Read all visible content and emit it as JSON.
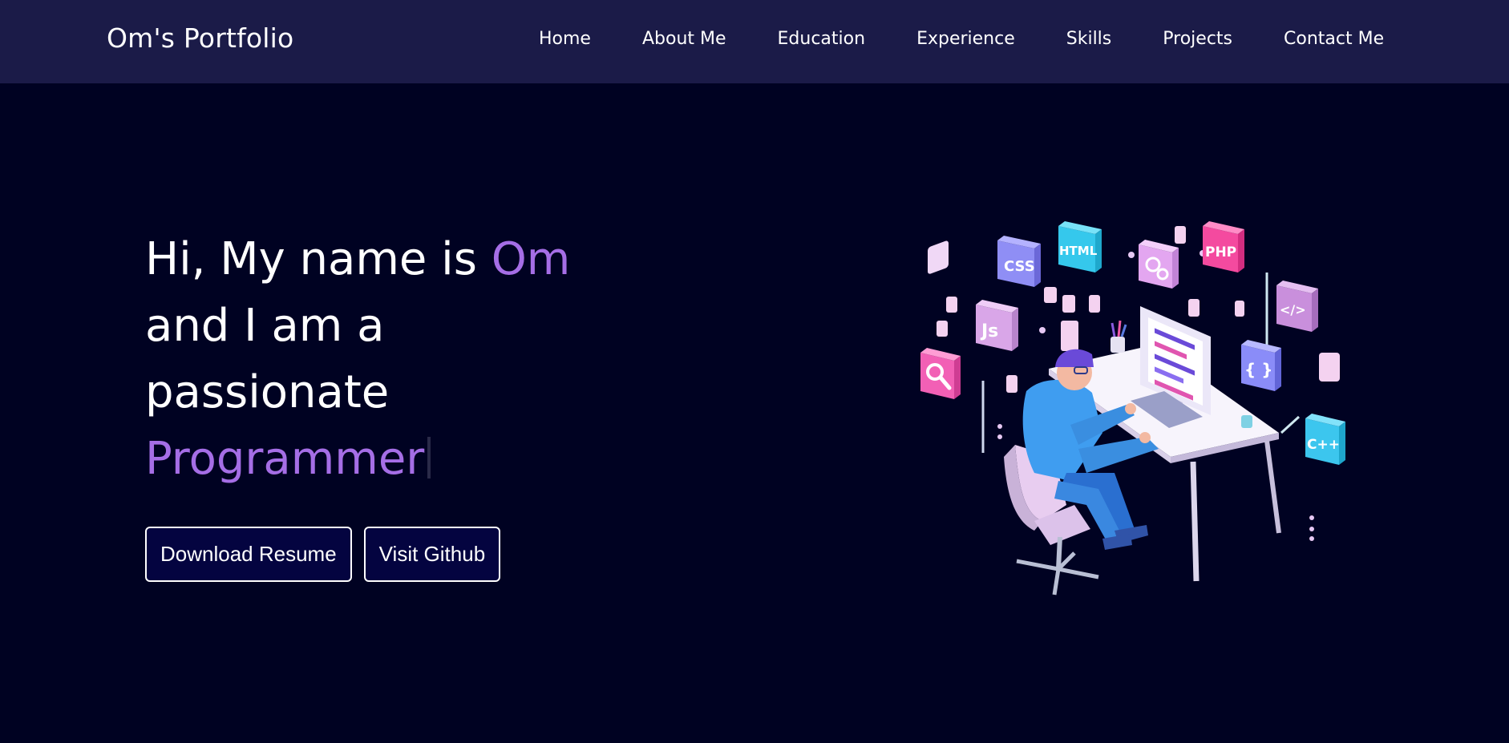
{
  "header": {
    "brand": "Om's Portfolio",
    "nav": [
      {
        "label": "Home"
      },
      {
        "label": "About Me"
      },
      {
        "label": "Education"
      },
      {
        "label": "Experience"
      },
      {
        "label": "Skills"
      },
      {
        "label": "Projects"
      },
      {
        "label": "Contact Me"
      }
    ]
  },
  "hero": {
    "greeting": "Hi, My name is ",
    "name": "Om",
    "line2": "and I am a",
    "line3": "passionate",
    "role": "Programmer",
    "buttons": {
      "resume": "Download Resume",
      "github": "Visit Github"
    }
  },
  "illustration": {
    "icons": [
      "CSS",
      "HTML",
      "PHP",
      "Js",
      "</>",
      "{ }",
      "C++"
    ]
  },
  "colors": {
    "background": "#000222",
    "navbar": "#1b1b48",
    "accent": "#a56ee6",
    "button_bg": "#040440"
  }
}
